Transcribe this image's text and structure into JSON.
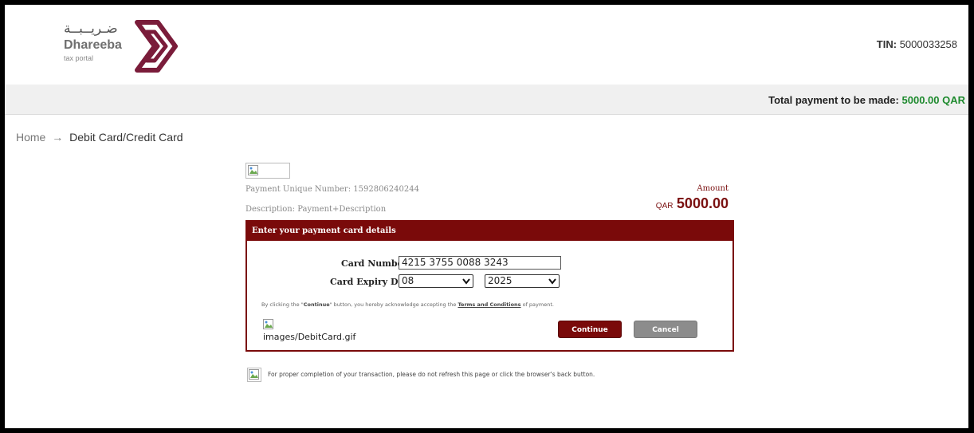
{
  "header": {
    "logo_arabic": "ضـريــبــة",
    "logo_name": "Dhareeba",
    "logo_sub": "tax portal",
    "tin_label": "TIN:",
    "tin_value": "5000033258"
  },
  "total_bar": {
    "label": "Total payment to be made:",
    "amount": "5000.00 QAR"
  },
  "breadcrumb": {
    "home": "Home",
    "arrow": "→",
    "current": "Debit Card/Credit Card"
  },
  "payment": {
    "unique_number": "Payment Unique Number: 1592806240244",
    "description": "Description: Payment+Description",
    "amount_label": "Amount",
    "currency": "QAR",
    "amount_value": "5000.00"
  },
  "card_form": {
    "heading": "Enter your payment card details",
    "card_number_label": "Card Number",
    "card_number_value": "4215 3755 0088 3243",
    "expiry_label": "Card Expiry Date",
    "expiry_month": "08",
    "expiry_year": "2025",
    "terms_prefix": "By clicking the \"",
    "terms_continue": "Continue",
    "terms_mid": "\" button, you hereby acknowledge accepting the ",
    "terms_link": "Terms and Conditions",
    "terms_suffix": " of payment.",
    "card_image_alt": "images/DebitCard.gif",
    "continue_label": "Continue",
    "cancel_label": "Cancel"
  },
  "notice": {
    "text": "For proper completion of your transaction, please do not refresh this page or click the browser's back button."
  },
  "colors": {
    "brand": "#7a0a0a",
    "total_amount": "#1e8a2e",
    "cancel": "#8c8c8c"
  }
}
